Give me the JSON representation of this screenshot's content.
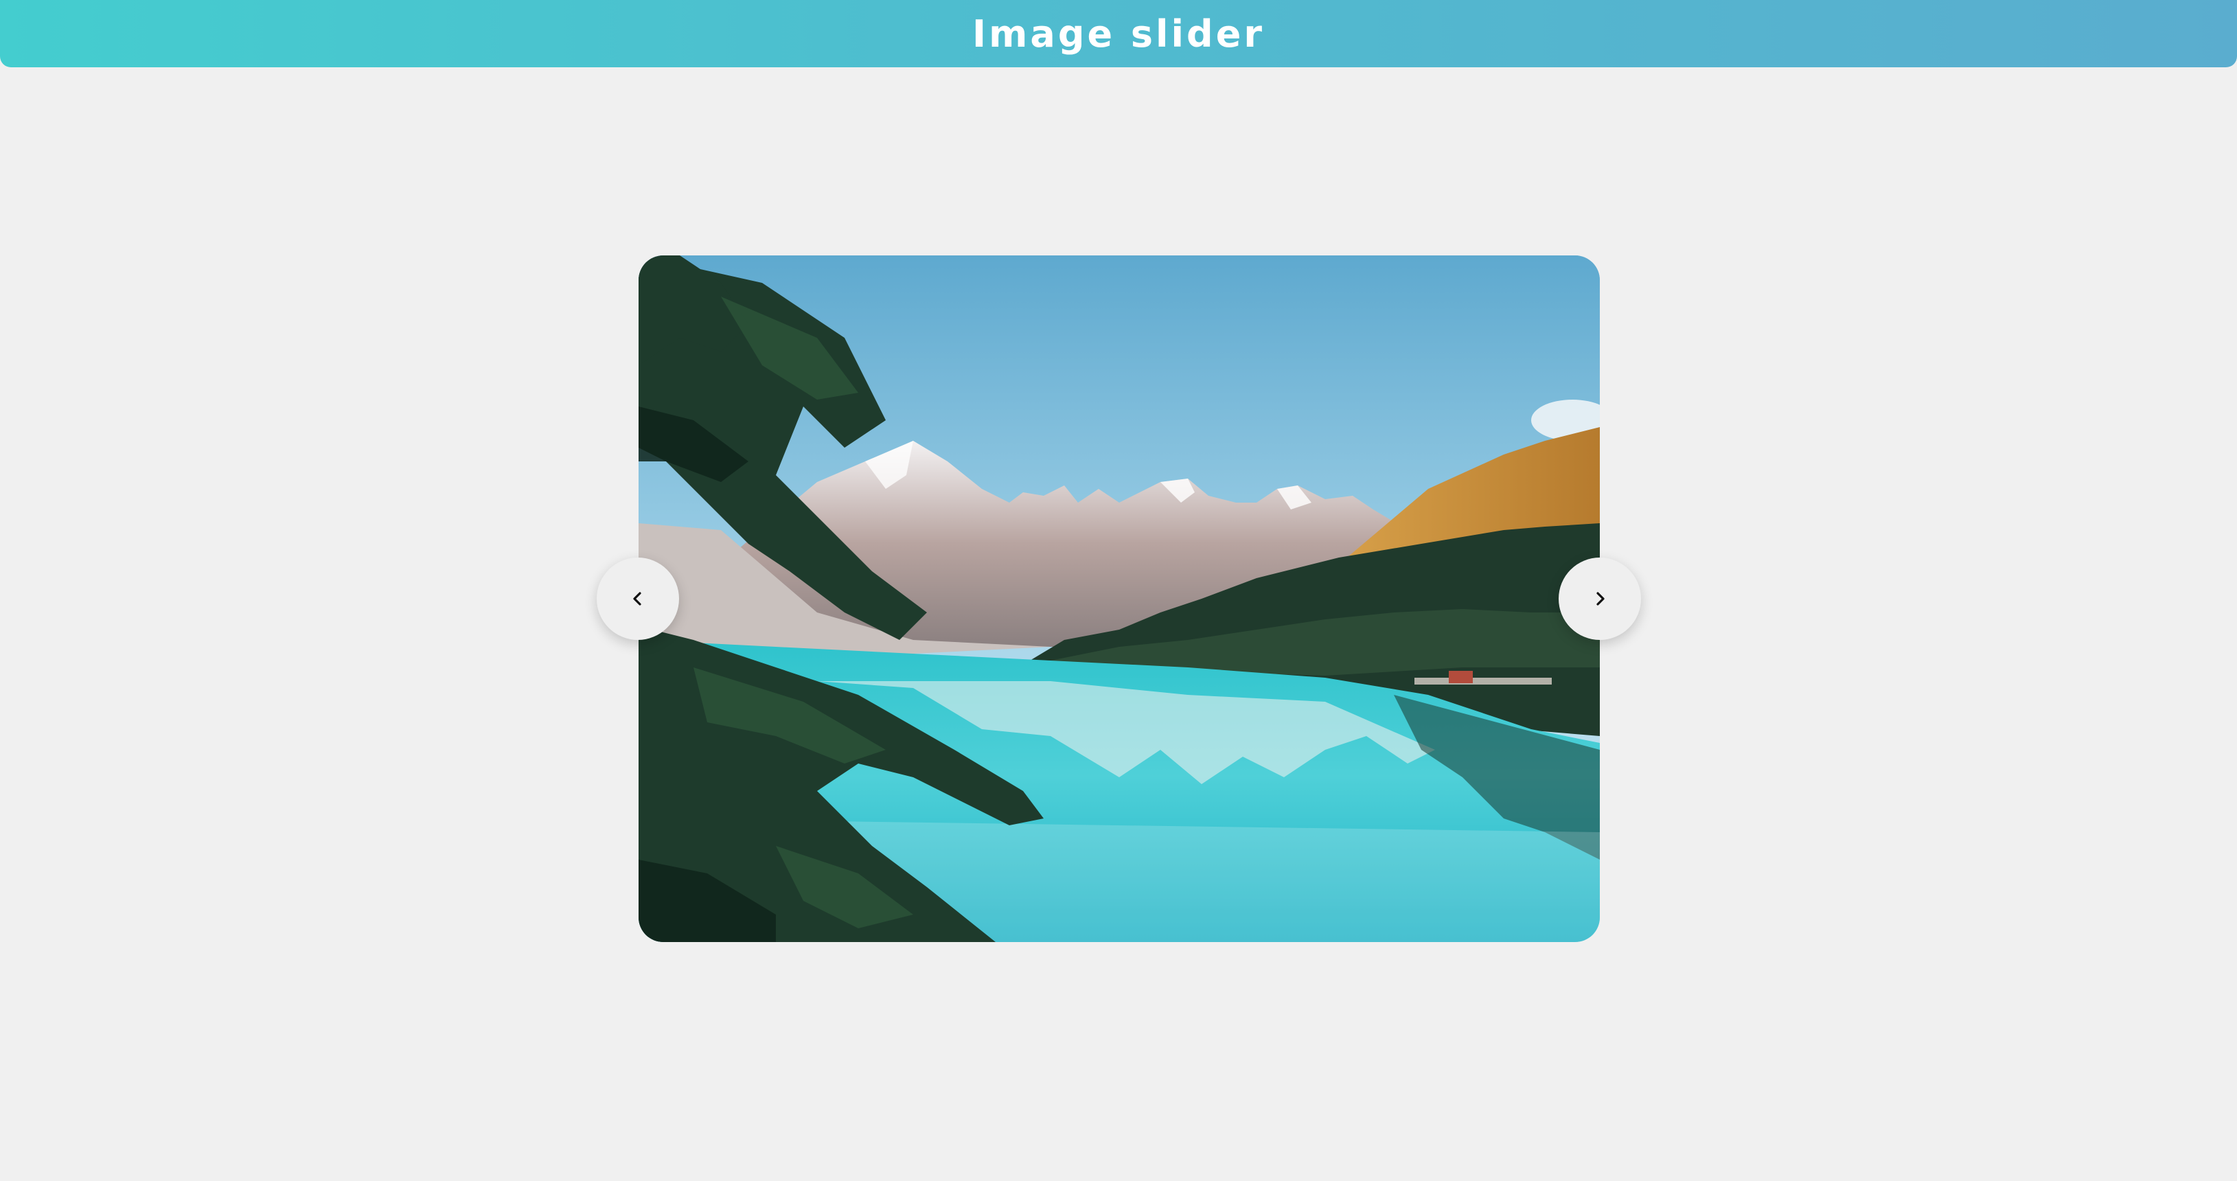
{
  "header": {
    "title": "Image slider"
  },
  "slider": {
    "slide_image": "mountain-lake-landscape",
    "prev_icon": "chevron-left-icon",
    "next_icon": "chevron-right-icon"
  },
  "colors": {
    "header_gradient_start": "#44cdcf",
    "header_gradient_end": "#5aadcf",
    "page_background": "#f0f0f0",
    "nav_button_background": "#efefef"
  }
}
